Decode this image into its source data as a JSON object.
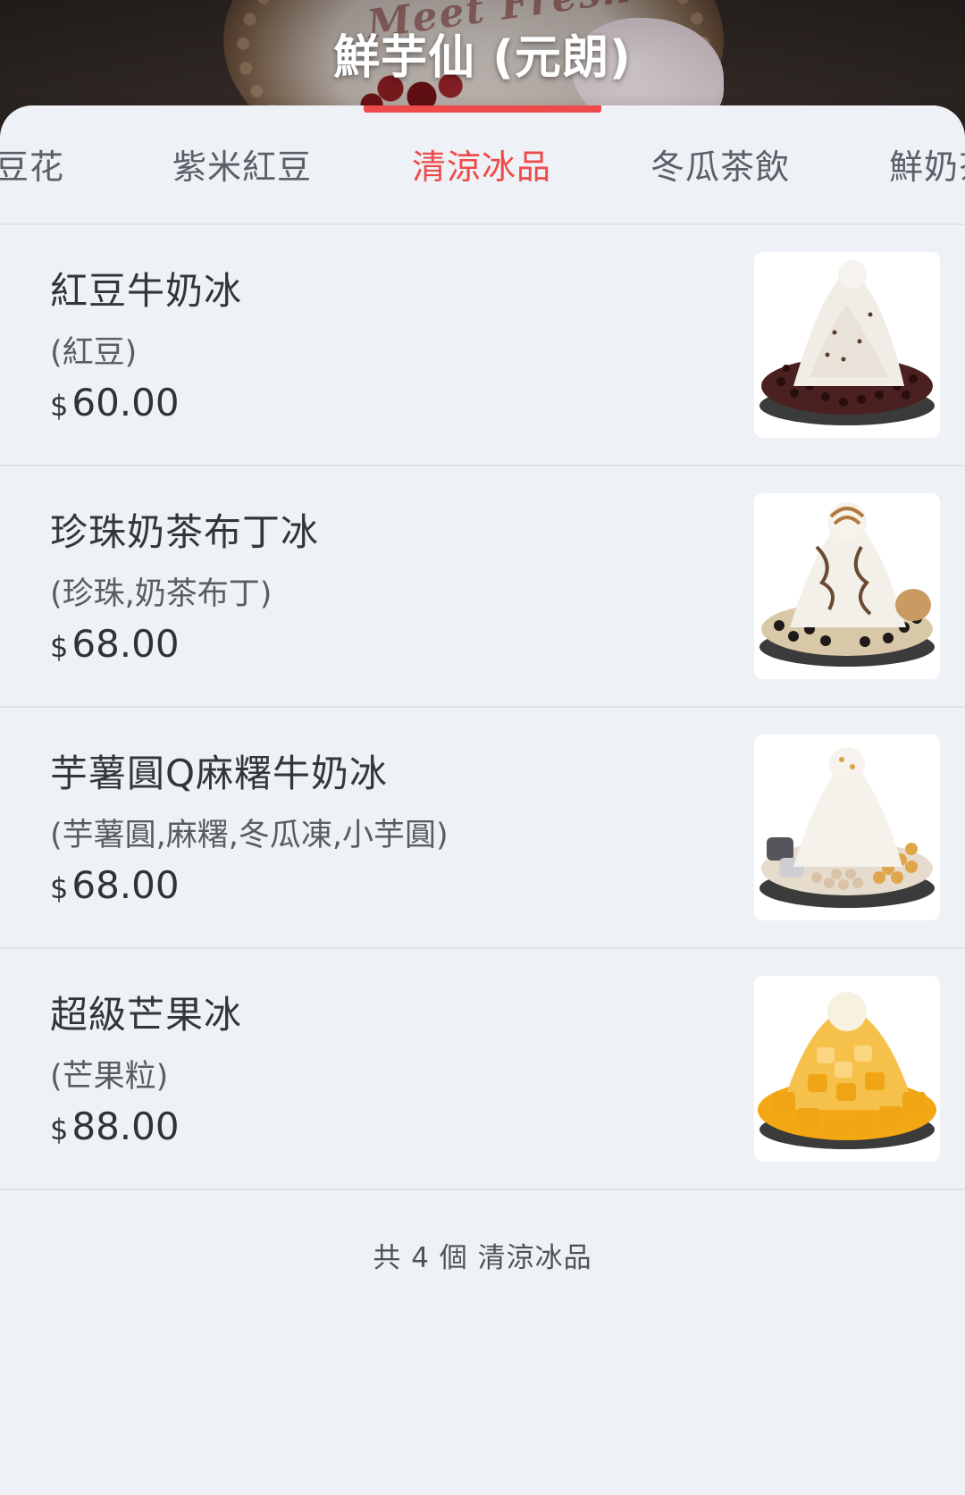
{
  "header": {
    "title": "鮮芋仙 (元朗)"
  },
  "tabs": [
    {
      "label": "豆花",
      "active": false
    },
    {
      "label": "紫米紅豆",
      "active": false
    },
    {
      "label": "清涼冰品",
      "active": true
    },
    {
      "label": "冬瓜茶飲",
      "active": false
    },
    {
      "label": "鮮奶茶",
      "active": false
    }
  ],
  "items": [
    {
      "name": "紅豆牛奶冰",
      "desc": "(紅豆)",
      "currency": "$",
      "price": "60.00",
      "image": "red-bean-milk-ice-image"
    },
    {
      "name": "珍珠奶茶布丁冰",
      "desc": "(珍珠,奶茶布丁)",
      "currency": "$",
      "price": "68.00",
      "image": "pearl-milk-tea-pudding-ice-image"
    },
    {
      "name": "芋薯圓Q麻糬牛奶冰",
      "desc": "(芋薯圓,麻糬,冬瓜凍,小芋圓)",
      "currency": "$",
      "price": "68.00",
      "image": "taro-ball-mochi-milk-ice-image"
    },
    {
      "name": "超級芒果冰",
      "desc": "(芒果粒)",
      "currency": "$",
      "price": "88.00",
      "image": "super-mango-ice-image"
    }
  ],
  "footer": {
    "count_text": "共 4 個 清涼冰品"
  }
}
